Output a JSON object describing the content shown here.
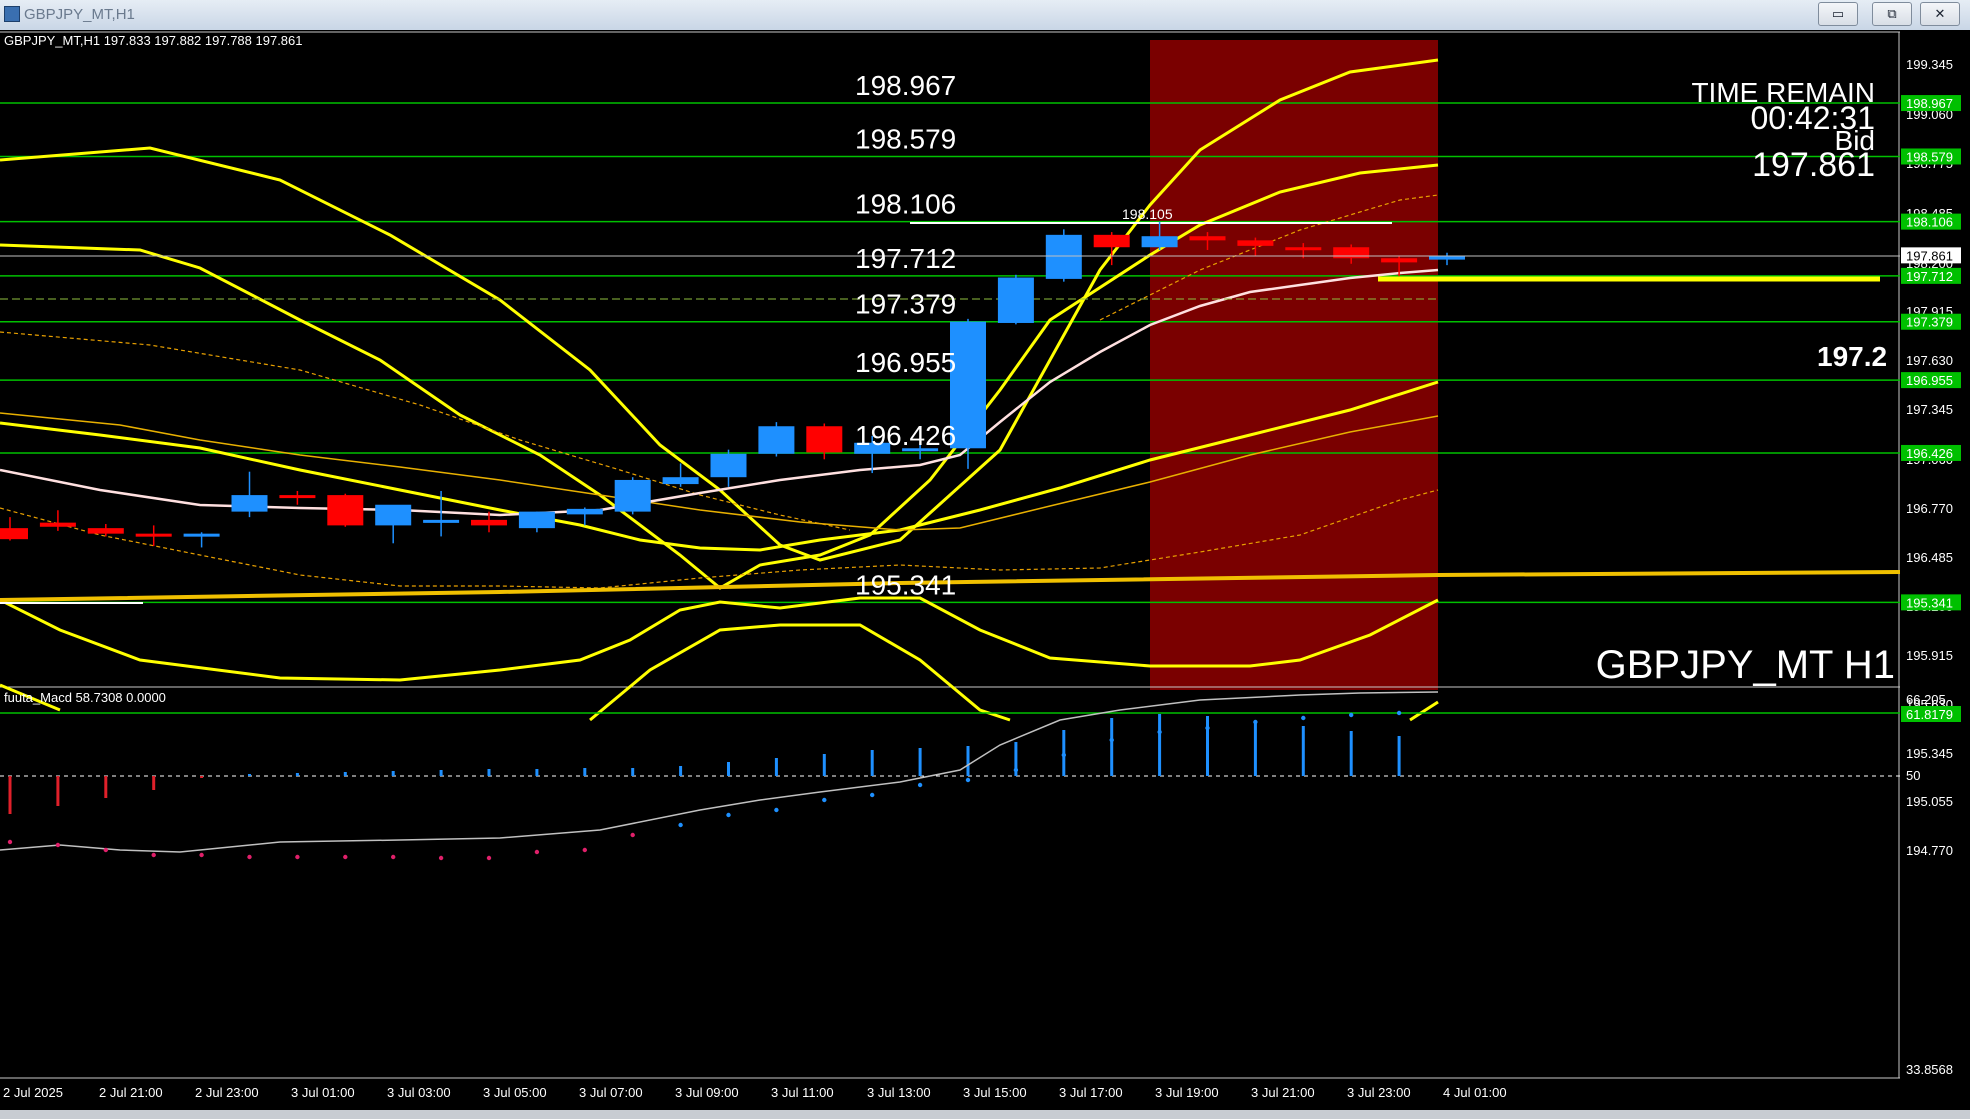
{
  "window": {
    "title": "GBPJPY_MT,H1",
    "buttons": {
      "minimize": "▭",
      "restore": "⧉",
      "close": "✕"
    }
  },
  "main": {
    "header": "GBPJPY_MT,H1  197.833 197.882 197.788 197.861",
    "symbol_label": "GBPJPY_MT H1",
    "time_remain_label": "TIME REMAIN",
    "time_remain_value": "00:42:31",
    "bid_label": "Bid",
    "bid_value": "197.861",
    "partial_price": "197.2",
    "high_marker": "198.105",
    "level_labels": [
      "198.967",
      "198.579",
      "198.106",
      "197.712",
      "197.379",
      "196.955",
      "196.426",
      "195.341"
    ],
    "axis_ticks": [
      "199.345",
      "199.060",
      "198.775",
      "198.485",
      "198.200",
      "197.915",
      "197.630",
      "197.345",
      "197.060",
      "196.770",
      "196.485",
      "196.200",
      "195.915",
      "195.630",
      "195.345",
      "195.055",
      "194.770"
    ],
    "axis_tags": [
      {
        "text": "198.967",
        "bg": "#00c000"
      },
      {
        "text": "198.579",
        "bg": "#00c000"
      },
      {
        "text": "198.106",
        "bg": "#00c000"
      },
      {
        "text": "197.861",
        "bg": "#ffffff"
      },
      {
        "text": "197.712",
        "bg": "#00c000"
      },
      {
        "text": "197.379",
        "bg": "#00c000"
      },
      {
        "text": "196.955",
        "bg": "#00c000"
      },
      {
        "text": "196.426",
        "bg": "#00c000"
      },
      {
        "text": "195.341",
        "bg": "#00c000"
      }
    ]
  },
  "macd": {
    "header": "fuuta_Macd 58.7308  0.0000",
    "axis_ticks": [
      "66.205",
      "50",
      "33.8568"
    ],
    "level_tag": "61.8179"
  },
  "time_axis": [
    "2 Jul 2025",
    "2 Jul 21:00",
    "2 Jul 23:00",
    "3 Jul 01:00",
    "3 Jul 03:00",
    "3 Jul 05:00",
    "3 Jul 07:00",
    "3 Jul 09:00",
    "3 Jul 11:00",
    "3 Jul 13:00",
    "3 Jul 15:00",
    "3 Jul 17:00",
    "3 Jul 19:00",
    "3 Jul 21:00",
    "3 Jul 23:00",
    "4 Jul 01:00"
  ],
  "colors": {
    "background": "#000000",
    "bull": "#1e90ff",
    "bear": "#ff0000",
    "level_line": "#00c000",
    "band": "#ffff00",
    "highlight_zone": "#7a0000"
  },
  "chart_data": {
    "type": "candlestick",
    "symbol": "GBPJPY_MT",
    "timeframe": "H1",
    "candles": [
      {
        "o": 195.88,
        "h": 195.96,
        "l": 195.79,
        "c": 195.8
      },
      {
        "o": 195.92,
        "h": 196.01,
        "l": 195.86,
        "c": 195.89
      },
      {
        "o": 195.88,
        "h": 195.91,
        "l": 195.82,
        "c": 195.84
      },
      {
        "o": 195.84,
        "h": 195.9,
        "l": 195.75,
        "c": 195.82
      },
      {
        "o": 195.82,
        "h": 195.85,
        "l": 195.74,
        "c": 195.84
      },
      {
        "o": 196.0,
        "h": 196.29,
        "l": 195.96,
        "c": 196.12
      },
      {
        "o": 196.12,
        "h": 196.15,
        "l": 196.05,
        "c": 196.1
      },
      {
        "o": 196.12,
        "h": 196.13,
        "l": 195.89,
        "c": 195.9
      },
      {
        "o": 195.9,
        "h": 195.98,
        "l": 195.77,
        "c": 196.05
      },
      {
        "o": 195.94,
        "h": 196.15,
        "l": 195.82,
        "c": 195.94
      },
      {
        "o": 195.94,
        "h": 196.0,
        "l": 195.85,
        "c": 195.9
      },
      {
        "o": 195.88,
        "h": 196.0,
        "l": 195.85,
        "c": 196.0
      },
      {
        "o": 195.98,
        "h": 196.03,
        "l": 195.9,
        "c": 196.02
      },
      {
        "o": 196.0,
        "h": 196.25,
        "l": 195.98,
        "c": 196.23
      },
      {
        "o": 196.2,
        "h": 196.35,
        "l": 196.18,
        "c": 196.25
      },
      {
        "o": 196.25,
        "h": 196.45,
        "l": 196.18,
        "c": 196.42
      },
      {
        "o": 196.42,
        "h": 196.65,
        "l": 196.4,
        "c": 196.62
      },
      {
        "o": 196.62,
        "h": 196.64,
        "l": 196.38,
        "c": 196.43
      },
      {
        "o": 196.42,
        "h": 196.55,
        "l": 196.28,
        "c": 196.5
      },
      {
        "o": 196.45,
        "h": 196.5,
        "l": 196.38,
        "c": 196.46
      },
      {
        "o": 196.46,
        "h": 197.4,
        "l": 196.31,
        "c": 197.38
      },
      {
        "o": 197.37,
        "h": 197.72,
        "l": 197.36,
        "c": 197.7
      },
      {
        "o": 197.69,
        "h": 198.05,
        "l": 197.67,
        "c": 198.01
      },
      {
        "o": 198.01,
        "h": 198.03,
        "l": 197.79,
        "c": 197.92
      },
      {
        "o": 197.92,
        "h": 198.105,
        "l": 197.9,
        "c": 198.0
      },
      {
        "o": 198.0,
        "h": 198.03,
        "l": 197.9,
        "c": 197.97
      },
      {
        "o": 197.97,
        "h": 197.99,
        "l": 197.86,
        "c": 197.93
      },
      {
        "o": 197.92,
        "h": 197.95,
        "l": 197.84,
        "c": 197.9
      },
      {
        "o": 197.92,
        "h": 197.94,
        "l": 197.8,
        "c": 197.84
      },
      {
        "o": 197.84,
        "h": 197.86,
        "l": 197.71,
        "c": 197.81
      },
      {
        "o": 197.83,
        "h": 197.88,
        "l": 197.79,
        "c": 197.86
      }
    ],
    "horizontal_levels": [
      198.967,
      198.579,
      198.106,
      197.712,
      197.379,
      196.955,
      196.426,
      195.341
    ],
    "current_price": 197.861,
    "ylim": [
      194.77,
      199.345
    ],
    "macd_ylim": [
      33.8568,
      66.205
    ]
  }
}
